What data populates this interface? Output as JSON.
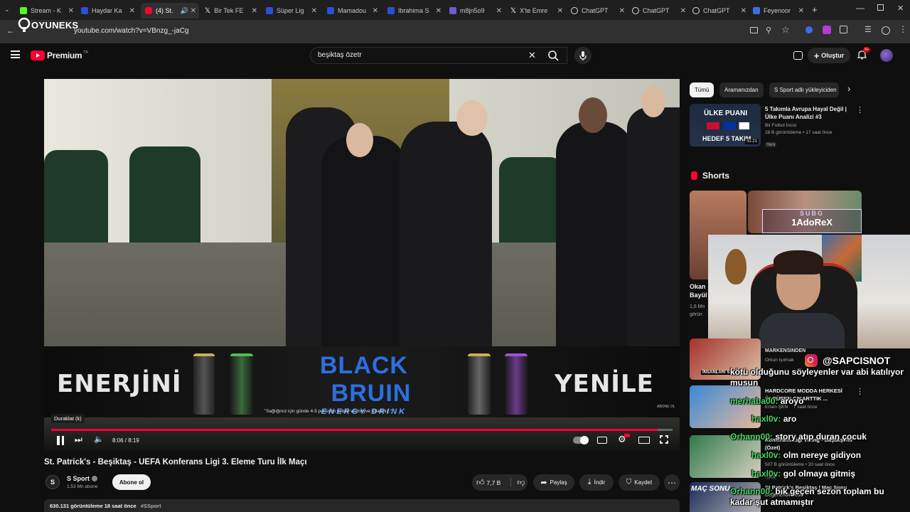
{
  "browser": {
    "tabs": [
      {
        "label": "Stream - K",
        "color": "#53fc18",
        "active": false
      },
      {
        "label": "Haydar Ka",
        "color": "#2b4fd6",
        "active": false
      },
      {
        "label": "(4) St.",
        "color": "#ff0033",
        "active": true
      },
      {
        "label": "Bir Tek FE",
        "color": "#e0e0e0",
        "active": false
      },
      {
        "label": "Süper Lig",
        "color": "#2b4fd6",
        "active": false
      },
      {
        "label": "Mamadou",
        "color": "#2b4fd6",
        "active": false
      },
      {
        "label": "Ibrahima S",
        "color": "#2b4fd6",
        "active": false
      },
      {
        "label": "m8jn5o9",
        "color": "#6b5bd6",
        "active": false
      },
      {
        "label": "X'te Emre",
        "color": "#e0e0e0",
        "active": false
      },
      {
        "label": "ChatGPT",
        "color": "#e0e0e0",
        "active": false
      },
      {
        "label": "ChatGPT",
        "color": "#e0e0e0",
        "active": false
      },
      {
        "label": "ChatGPT",
        "color": "#e0e0e0",
        "active": false
      },
      {
        "label": "Feyenoor",
        "color": "#3b6fe0",
        "active": false
      }
    ],
    "url": "youtube.com/watch?v=VBnzg_-jaCg",
    "overlay_logo": "OYUNEKS"
  },
  "youtube": {
    "logo_text": "Premium",
    "logo_sup": "TR",
    "search_value": "beşiktaş özetr",
    "create_label": "Oluştur",
    "notif_count": "9+"
  },
  "video": {
    "ad_left": "ENERJİNİ",
    "ad_brand_1": "BLACK",
    "ad_brand_2": "BRUIN",
    "ad_sub": "ENERGY DRINK",
    "ad_notice": "\"Sağlığınız için günde 4-5 porsiyon sebze ve meyve tüketiniz.\"",
    "ad_right": "YENİLE",
    "tooltip": "Duraklat (k)",
    "time": "8:06 / 8:19",
    "progress": 0.976,
    "abone_watermark": "ABONE OL",
    "streamer_name": "1AdoReX",
    "streamer_tag": "SUBG"
  },
  "meta": {
    "title": "St. Patrick's - Beşiktaş - UEFA Konferans Ligi 3. Eleme Turu İlk Maçı",
    "channel": "S Sport",
    "subs": "1,53 Mn abone",
    "subscribe": "Abone ol",
    "likes": "7,7 B",
    "share": "Paylaş",
    "download": "İndir",
    "save": "Kaydet",
    "views_line": "630.131 görüntüleme  18 saat önce",
    "hashtag": "#SSport"
  },
  "sidebar": {
    "chips": [
      "Tümü",
      "Aramanızdan",
      "S Sport adlı yükleyiciden"
    ],
    "first": {
      "title": "5 Takımla Avrupa Hayal Değil | Ülke Puanı Analizi #3",
      "channel": "Bir Futbol İncisi",
      "meta": "28 B görüntüleme • 17 saat önce",
      "badge": "Yeni",
      "thumb_top": "ÜLKE PUANI",
      "thumb_bottom": "HEDEF 5 TAKIM",
      "duration": "11:21"
    },
    "shorts_label": "Shorts",
    "short_partial_1": "Okan",
    "short_partial_2": "Bayül",
    "short_partial_3": "1,6 Mn",
    "short_partial_4": "görün",
    "videos": [
      {
        "title": "MARKENSINDEN",
        "channel": "Orkun Işıtmak",
        "meta": "",
        "thumb": "İNSANLARI SEÇİ"
      },
      {
        "title": "HARDCORE MODDA HERKESİ ÖLDÜREN ÇIKARTTIK ...",
        "channel": "Ersen ŞEN",
        "meta": "7 saat önce",
        "badge": "Yeni"
      },
      {
        "title": "Konferans Ligi Viking - Başakşehir (Özet)",
        "channel": "",
        "meta": "507 B görüntüleme • 20 saat önce",
        "badge": "Yeni"
      },
      {
        "title": "St Patrick's Beşiktaş | Maç Sonu",
        "channel": "Değerlendirmesi",
        "meta": "",
        "thumb": "MAÇ SONU"
      }
    ]
  },
  "stream_overlay": {
    "social": "@SAPCISNOT",
    "chat": [
      {
        "user": "",
        "text": "kötü olduğunu söyleyenler var abi katılıyor musun"
      },
      {
        "user": "merhaba00:",
        "text": "aroyo"
      },
      {
        "user": "haxl0v:",
        "text": "aro"
      },
      {
        "user": "Orhann00:",
        "text": "story atıp duran çocuk"
      },
      {
        "user": "haxl0v:",
        "text": "olm nereye gidiyon"
      },
      {
        "user": "haxl0v:",
        "text": "gol olmaya gitmiş"
      },
      {
        "user": "Orhann00:",
        "text": "bık geçen sezon toplam bu kadar şut atmamıştır"
      }
    ]
  }
}
